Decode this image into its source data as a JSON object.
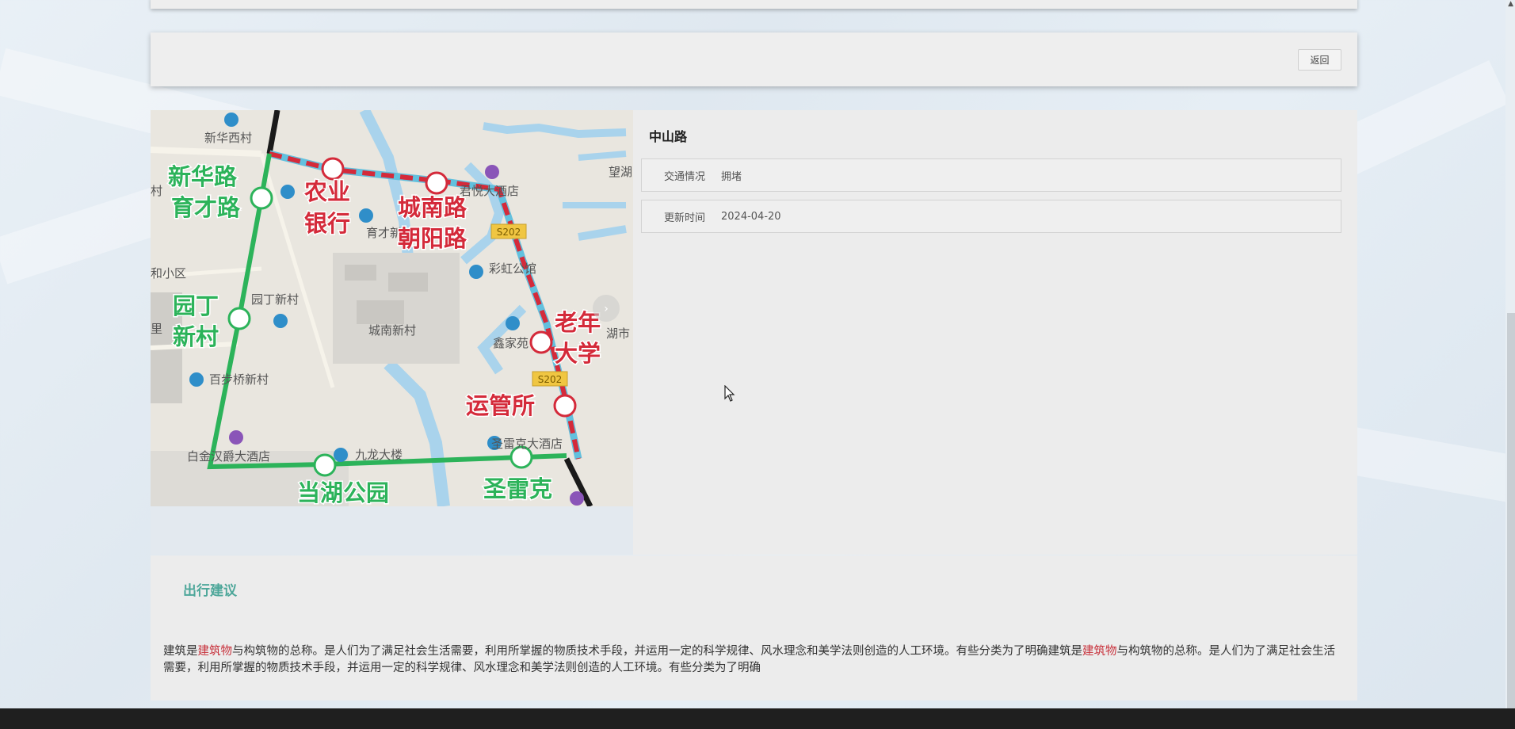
{
  "toolbar": {
    "back_label": "返回"
  },
  "road": {
    "name": "中山路",
    "fields": [
      {
        "label": "交通情况",
        "value": "拥堵"
      },
      {
        "label": "更新时间",
        "value": "2024-04-20"
      }
    ]
  },
  "map": {
    "stops": [
      {
        "name1": "新华路",
        "name2": "育才路"
      },
      {
        "name1": "农业",
        "name2": "银行"
      },
      {
        "name1": "城南路",
        "name2": "朝阳路"
      },
      {
        "name1": "园丁",
        "name2": "新村"
      },
      {
        "name1": "老年",
        "name2": "大学"
      },
      {
        "name1": "运管所"
      },
      {
        "name1": "当湖公园"
      },
      {
        "name1": "圣雷克"
      }
    ],
    "places": [
      "新华西村",
      "育才新村",
      "园丁新村",
      "城南新村",
      "彩虹公馆",
      "鑫家苑",
      "百步桥新村",
      "白金汉爵大酒店",
      "九龙大楼",
      "圣雷克大酒店",
      "君悦大酒店",
      "和小区",
      "望湖",
      "湖市",
      "村",
      "里"
    ],
    "road_badges": [
      "S202",
      "S202"
    ],
    "colors": {
      "green_line": "#2cb35a",
      "congested": "#d42a3a",
      "road_blue": "#62c0de"
    }
  },
  "advice": {
    "title": "出行建议",
    "text_parts": [
      "建筑是",
      "建筑物",
      "与构筑物的总称。是人们为了满足社会生活需要，利用所掌握的物质技术手段，并运用一定的科学规律、风水理念和美学法则创造的人工环境。有些分类为了明确建筑是",
      "建筑物",
      "与构筑物的总称。是人们为了满足社会生活需要，利用所掌握的物质技术手段，并运用一定的科学规律、风水理念和美学法则创造的人工环境。有些分类为了明确"
    ]
  }
}
